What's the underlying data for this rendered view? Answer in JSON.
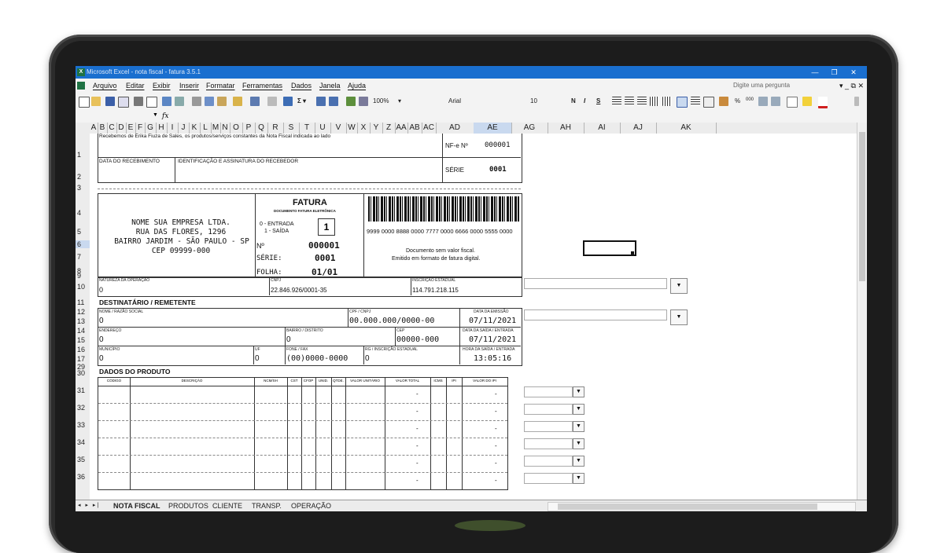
{
  "window": {
    "title": "Microsoft Excel - nota fiscal - fatura 3.5.1",
    "controls": [
      "—",
      "❐",
      "✕"
    ]
  },
  "menu": {
    "items": [
      "Arquivo",
      "Editar",
      "Exibir",
      "Inserir",
      "Formatar",
      "Ferramentas",
      "Dados",
      "Janela",
      "Ajuda"
    ],
    "help_placeholder": "Digite uma pergunta",
    "controls": "▾ _ ⧉ ✕"
  },
  "toolbar": {
    "zoom": "100%",
    "font": "Arial",
    "font_size": "10",
    "bold": "N",
    "italic": "I",
    "underline": "S",
    "percent": "%",
    "thousands": "000"
  },
  "formula": {
    "fx": "fx"
  },
  "columns": [
    "A",
    "B",
    "C",
    "D",
    "E",
    "F",
    "G",
    "H",
    "I",
    "J",
    "K",
    "L",
    "M",
    "N",
    "O",
    "P",
    "Q",
    "R",
    "S",
    "T",
    "U",
    "V",
    "W",
    "X",
    "Y",
    "Z",
    "AA",
    "AB",
    "AC",
    "AD",
    "AE",
    "AG",
    "AH",
    "AI",
    "AJ",
    "AK"
  ],
  "rows": [
    "1",
    "2",
    "3",
    "4",
    "5",
    "6",
    "7",
    "8",
    "9",
    "10",
    "11",
    "12",
    "13",
    "14",
    "15",
    "16",
    "17",
    "29",
    "30",
    "31",
    "32",
    "33",
    "34",
    "35",
    "36"
  ],
  "canhoto": {
    "text": "Recebemos de Érika Fiuza de Sales, os produtos/serviços constantes da Nota Fiscal indicada ao lado",
    "nfe_label": "NF-e Nº",
    "nfe_number": "000001",
    "recv_date_label": "DATA DO RECEBIMENTO",
    "signature_label": "IDENTIFICAÇÃO E ASSINATURA DO RECEBEDOR",
    "serie_label": "SÉRIE",
    "serie": "0001"
  },
  "company": {
    "name": "NOME SUA EMPRESA LTDA.",
    "street": "RUA DAS FLORES, 1296",
    "city": "BAIRRO JARDIM - SÃO PAULO - SP",
    "cep": "CEP 09999-000"
  },
  "fatura": {
    "title": "FATURA",
    "subtitle": "DOCUMENTO FATURA ELETRÔNICA",
    "entrada": "0 - ENTRADA",
    "saida": "1 - SAÍDA",
    "tipo": "1",
    "no_label": "Nº",
    "number": "000001",
    "serie_label": "SÉRIE:",
    "serie": "0001",
    "folha_label": "FOLHA:",
    "folha": "01/01"
  },
  "access": {
    "key": "9999 0000 8888 0000 7777 0000 6666 0000 5555 0000",
    "note1": "Documento sem valor fiscal.",
    "note2": "Emitido em formato de fatura digital."
  },
  "operacao": {
    "nat_label": "NATUREZA DA OPERAÇÃO",
    "nat": "0",
    "cnpj_label": "CNPJ",
    "cnpj": "22.846.926/0001-35",
    "ie_label": "INSCRIÇÃO ESTADUAL",
    "ie": "114.791.218.115"
  },
  "destinatario": {
    "section": "DESTINATÁRIO / REMETENTE",
    "nome_label": "NOME / RAZÃO SOCIAL",
    "nome": "0",
    "cpf_label": "CPF / CNPJ",
    "cpf": "00.000.000/0000-00",
    "emissao_label": "DATA DA EMISSÃO",
    "emissao": "07/11/2021",
    "end_label": "ENDEREÇO",
    "endereco": "0",
    "bairro_label": "BAIRRO / DISTRITO",
    "bairro": "0",
    "cep_label": "CEP",
    "cep": "00000-000",
    "saida_label": "DATA DA SAÍDA / ENTRADA",
    "saida": "07/11/2021",
    "mun_label": "MUNICÍPIO",
    "municipio": "0",
    "uf_label": "UF",
    "uf": "0",
    "fone_label": "FONE / FAX",
    "fone": "(00)0000-0000",
    "rg_label": "RG / INSCRIÇÃO ESTADUAL",
    "rg": "0",
    "hora_label": "HORA DA SAÍDA / ENTRADA",
    "hora": "13:05:16"
  },
  "produtos": {
    "section": "DADOS DO PRODUTO",
    "headers": [
      "CÓDIGO",
      "DESCRIÇÃO",
      "NCM/SH",
      "CST",
      "CFOP",
      "UNID.",
      "QTDE.",
      "VALOR UNITÁRIO",
      "VALOR TOTAL",
      "ICMS",
      "IPI",
      "VALOR DO IPI"
    ],
    "rows": [
      {
        "total": "-",
        "ipi": "-"
      },
      {
        "total": "-",
        "ipi": "-"
      },
      {
        "total": "-",
        "ipi": "-"
      },
      {
        "total": "-",
        "ipi": "-"
      },
      {
        "total": "-",
        "ipi": "-"
      },
      {
        "total": "-",
        "ipi": "-"
      }
    ]
  },
  "sheets": {
    "active": "NOTA FISCAL",
    "others": [
      "PRODUTOS",
      "CLIENTE",
      "TRANSP.",
      "OPERAÇÃO"
    ]
  }
}
